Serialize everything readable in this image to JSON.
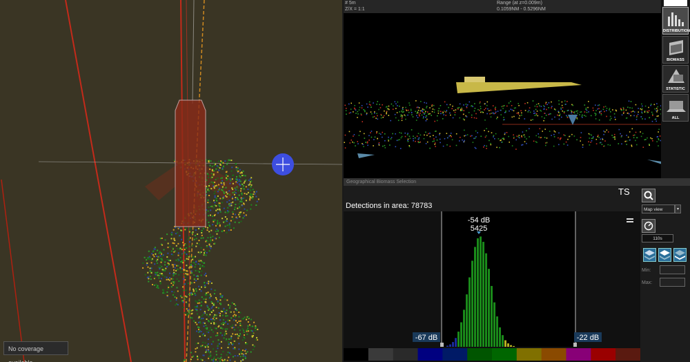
{
  "map": {
    "coverage_text": "No coverage available"
  },
  "echogram": {
    "depth_label": "# 5m",
    "zoom_label": "Z/X = 1:1",
    "range_label": "Range (at z=0.009m)",
    "range_values": "0.1059NM - 0.5296NM"
  },
  "tools": [
    {
      "label": "DISTRIBUTION",
      "icon": "distribution-icon",
      "active": true
    },
    {
      "label": "BIOMASS",
      "icon": "biomass-icon",
      "active": false
    },
    {
      "label": "STATISTIC",
      "icon": "statistic-icon",
      "active": false
    },
    {
      "label": "ALL",
      "icon": "all-icon",
      "active": false
    }
  ],
  "biomass": {
    "title": "Geographical Biomass Selection",
    "mode": "TS",
    "detections_label": "Detections in area:",
    "detections_value": "78783",
    "peak_db": "-54 dB",
    "peak_count": "5425",
    "min_db": "-67 dB",
    "max_db": "-22 dB",
    "view_select": "Map view",
    "time_value": "110s",
    "min_label": "Min:",
    "max_label": "Max:"
  },
  "colors": {
    "map_bg": "#3a3524",
    "vessel_track": "#c42a1a",
    "selection_box": "#8b2a18",
    "accent_blue": "#3d4ee0",
    "scale": [
      "#000000",
      "#3a3a3a",
      "#2a2a2a",
      "#000080",
      "#001a66",
      "#005500",
      "#006600",
      "#807000",
      "#8a4a00",
      "#880077",
      "#9a0000",
      "#5a1a10"
    ]
  }
}
